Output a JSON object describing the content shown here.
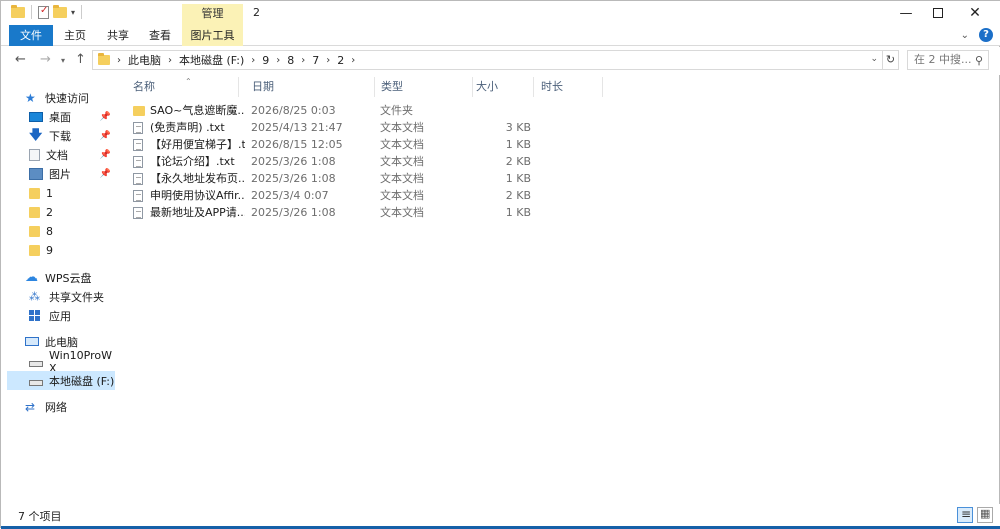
{
  "window": {
    "title": "2",
    "context_tab": "管理",
    "colors": {
      "file_tab": "#1979ca",
      "context": "#fbf2b6",
      "selected": "#cce8ff"
    }
  },
  "ribbon": {
    "tabs": [
      "文件",
      "主页",
      "共享",
      "查看",
      "图片工具"
    ]
  },
  "address": {
    "crumbs": [
      "此电脑",
      "本地磁盘 (F:)",
      "9",
      "8",
      "7",
      "2"
    ],
    "search_placeholder": "在 2 中搜..."
  },
  "sidebar": {
    "quick_access": "快速访问",
    "items": [
      {
        "label": "桌面",
        "icon": "desktop-icon"
      },
      {
        "label": "下载",
        "icon": "download-icon"
      },
      {
        "label": "文档",
        "icon": "document-icon"
      },
      {
        "label": "图片",
        "icon": "picture-icon"
      },
      {
        "label": "1",
        "icon": "folder-icon"
      },
      {
        "label": "2",
        "icon": "folder-icon"
      },
      {
        "label": "8",
        "icon": "folder-icon"
      },
      {
        "label": "9",
        "icon": "folder-icon"
      }
    ],
    "wps": "WPS云盘",
    "shared": "共享文件夹",
    "apps": "应用",
    "this_pc": "此电脑",
    "drive1": "Win10ProW X",
    "drive2": "本地磁盘 (F:)",
    "network": "网络"
  },
  "columns": {
    "name": "名称",
    "date": "日期",
    "type": "类型",
    "size": "大小",
    "duration": "时长"
  },
  "files": [
    {
      "name": "SAO~气息遮断魔...",
      "date": "2026/8/25 0:03",
      "type": "文件夹",
      "size": "",
      "kind": "folder"
    },
    {
      "name": "(免责声明) .txt",
      "date": "2025/4/13 21:47",
      "type": "文本文档",
      "size": "3 KB",
      "kind": "txt"
    },
    {
      "name": "【好用便宜梯子】.txt",
      "date": "2026/8/15 12:05",
      "type": "文本文档",
      "size": "1 KB",
      "kind": "txt"
    },
    {
      "name": "【论坛介绍】.txt",
      "date": "2025/3/26 1:08",
      "type": "文本文档",
      "size": "2 KB",
      "kind": "txt"
    },
    {
      "name": "【永久地址发布页...",
      "date": "2025/3/26 1:08",
      "type": "文本文档",
      "size": "1 KB",
      "kind": "txt"
    },
    {
      "name": "申明使用协议Affir...",
      "date": "2025/3/4 0:07",
      "type": "文本文档",
      "size": "2 KB",
      "kind": "txt"
    },
    {
      "name": "最新地址及APP请...",
      "date": "2025/3/26 1:08",
      "type": "文本文档",
      "size": "1 KB",
      "kind": "txt"
    }
  ],
  "status": {
    "count": "7 个项目"
  }
}
